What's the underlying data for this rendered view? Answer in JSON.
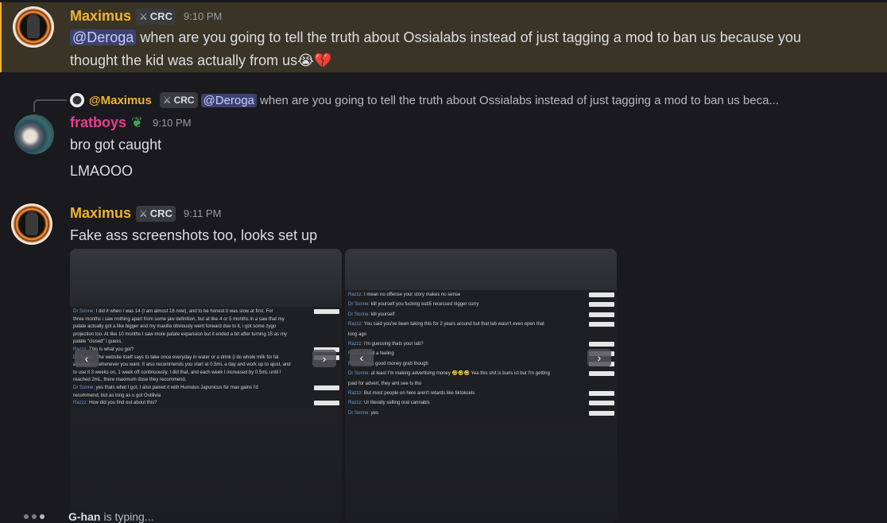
{
  "messages": [
    {
      "username": "Maximus",
      "tag": "CRC",
      "time": "9:10 PM",
      "mention": "@Deroga",
      "text_line1": " when are you going to tell the truth about Ossialabs instead of just tagging a mod to ban us because you",
      "text_line2": "thought the kid was actually from us",
      "emojis": "😭💔"
    },
    {
      "reply": {
        "username": "@Maximus",
        "tag": "CRC",
        "mention": "@Deroga",
        "text": " when are you going to tell the truth about Ossialabs instead of just tagging a mod to ban us beca..."
      },
      "username": "fratboys",
      "time": "9:10 PM",
      "lines": [
        "bro got caught",
        "LMAOOO"
      ]
    },
    {
      "username": "Maximus",
      "tag": "CRC",
      "time": "9:11 PM",
      "text": "Fake ass screenshots too, looks set up"
    }
  ],
  "screenshot1": {
    "lines": [
      {
        "who": "Dr Sonne:",
        "text": " I did it when I was 14 (I am almost 16 now), and to be honest it was slow at first. For"
      },
      {
        "who": "",
        "text": "three months i saw nothing apart from some jaw definition, but at like 4 or 5 months in a saw that my"
      },
      {
        "who": "",
        "text": "palate actually got a like bigger and my maxilla obviously went forward due to it, i got some zygo"
      },
      {
        "who": "",
        "text": "projection too. At like 10 months I saw more palate expansion but it ended a bit after turning 15 as my"
      },
      {
        "who": "",
        "text": "palate \"closed\" i guess."
      },
      {
        "who": "Razzz:",
        "text": " This is what you got?"
      },
      {
        "who": "Dr Sonne:",
        "text": " The website itself says to take once everyday in water or a drink (i do whole milk for fat"
      },
      {
        "who": "",
        "text": "absorption) whenever you want. It also recommends you start at 0.5mL a day and work up to ajust, and"
      },
      {
        "who": "",
        "text": "to use it 3 weeks on, 1 week off continuously. I did that, and each week I increased by 0.5mL until I"
      },
      {
        "who": "",
        "text": "reached 2mL, there maximum dose they recommend."
      },
      {
        "who": "Dr Sonne:",
        "text": " yes thats what I got, I also paired it with Humulus Japonicus for max gains i'd"
      },
      {
        "who": "",
        "text": "recommend, but as long as u got Ostilivia"
      },
      {
        "who": "Razzz:",
        "text": " How did you find out about this?"
      }
    ]
  },
  "screenshot2": {
    "lines": [
      {
        "who": "Razzz:",
        "text": " I mean no offense your story makes no sense"
      },
      {
        "who": "Dr Sonne:",
        "text": " kill yourself you fucking sub5 recessed nigger curry"
      },
      {
        "who": "Dr Sonne:",
        "text": " kill yourself"
      },
      {
        "who": "Razzz:",
        "text": " You said you've been taking this for 2 years around but that lab wasn't even open that"
      },
      {
        "who": "",
        "text": "long ago"
      },
      {
        "who": "Razzz:",
        "text": " I'm guessing thats your lab?"
      },
      {
        "who": "Razzz:",
        "text": " I had a feeling"
      },
      {
        "who": "Razzz:",
        "text": " It's a good money grab though"
      },
      {
        "who": "Dr Sonne:",
        "text": " at least I'm making advertising money 🤣🤣🤣 Yea this shit is buns icl but I'm getting"
      },
      {
        "who": "",
        "text": "paid for advert, they aint see ts tho"
      },
      {
        "who": "Razzz:",
        "text": " But most people on here aren't retards like tiktokcels"
      },
      {
        "who": "Razzz:",
        "text": " Ur literally selling oral cannabis"
      },
      {
        "who": "Dr Sonne:",
        "text": " yes"
      }
    ]
  },
  "typing": {
    "name": "G-han",
    "text": "is typing..."
  }
}
